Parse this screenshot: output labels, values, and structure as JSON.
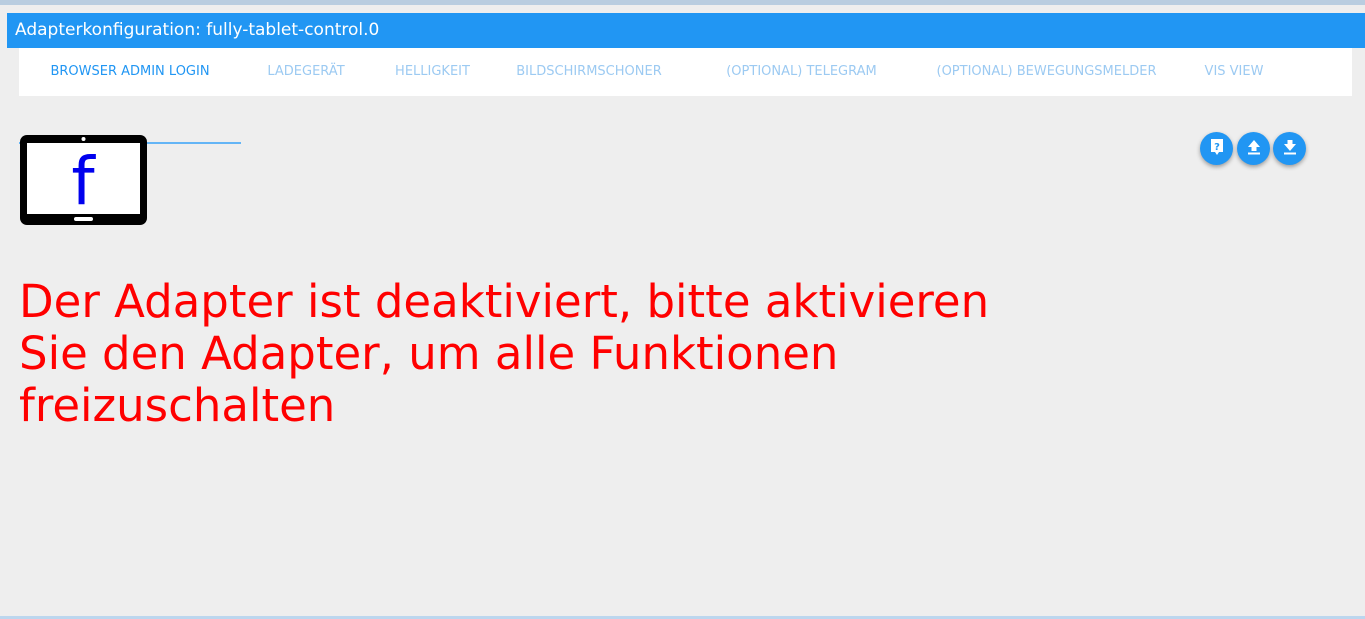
{
  "window": {
    "title": "Adapterkonfiguration: fully-tablet-control.0"
  },
  "tabs": [
    {
      "label": "BROWSER ADMIN LOGIN",
      "active": true
    },
    {
      "label": "LADEGERÄT",
      "active": false
    },
    {
      "label": "HELLIGKEIT",
      "active": false
    },
    {
      "label": "BILDSCHIRMSCHONER",
      "active": false
    },
    {
      "label": "(OPTIONAL) TELEGRAM",
      "active": false
    },
    {
      "label": "(OPTIONAL) BEWEGUNGSMELDER",
      "active": false
    },
    {
      "label": "VIS VIEW",
      "active": false
    }
  ],
  "logo": {
    "letter": "f",
    "icon": "tablet-logo-icon"
  },
  "actions": [
    {
      "name": "help-button",
      "icon": "help-icon"
    },
    {
      "name": "upload-button",
      "icon": "upload-icon"
    },
    {
      "name": "download-button",
      "icon": "download-icon"
    }
  ],
  "main": {
    "warning": "Der Adapter ist deaktiviert, bitte aktivieren Sie den Adapter, um alle Funktionen freizuschalten"
  },
  "colors": {
    "accent": "#2196f3",
    "warning": "#ff0000",
    "background": "#eeeeee"
  }
}
